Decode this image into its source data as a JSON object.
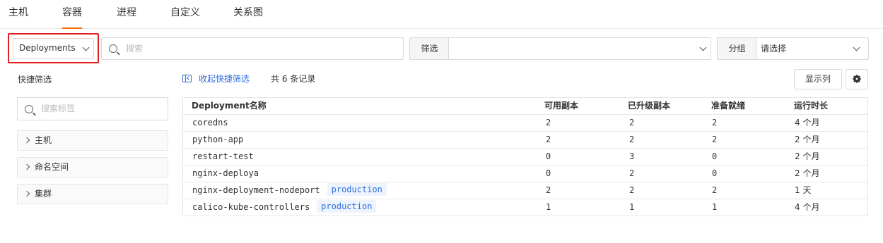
{
  "tabs": [
    {
      "label": "主机"
    },
    {
      "label": "容器"
    },
    {
      "label": "进程"
    },
    {
      "label": "自定义"
    },
    {
      "label": "关系图"
    }
  ],
  "toolbar": {
    "resource_select": "Deployments",
    "search_placeholder": "搜索",
    "filter_label": "筛选",
    "filter_value": "",
    "group_label": "分组",
    "group_placeholder": "请选择"
  },
  "quick_filter": {
    "title": "快捷筛选",
    "search_placeholder": "搜索标签",
    "items": [
      {
        "label": "主机"
      },
      {
        "label": "命名空间"
      },
      {
        "label": "集群"
      }
    ]
  },
  "list_header": {
    "collapse_label": "收起快捷筛选",
    "record_count": "共 6 条记录",
    "columns_button": "显示列"
  },
  "table": {
    "columns": [
      "Deployment名称",
      "可用副本",
      "已升级副本",
      "准备就绪",
      "运行时长"
    ],
    "rows": [
      {
        "name": "coredns",
        "tag": "",
        "available": "2",
        "updated": "2",
        "ready": "2",
        "age": "4 个月"
      },
      {
        "name": "python-app",
        "tag": "",
        "available": "2",
        "updated": "2",
        "ready": "2",
        "age": "2 个月"
      },
      {
        "name": "restart-test",
        "tag": "",
        "available": "0",
        "updated": "3",
        "ready": "0",
        "age": "2 个月"
      },
      {
        "name": "nginx-deploya",
        "tag": "",
        "available": "0",
        "updated": "2",
        "ready": "0",
        "age": "2 个月"
      },
      {
        "name": "nginx-deployment-nodeport",
        "tag": "production",
        "available": "2",
        "updated": "2",
        "ready": "2",
        "age": "1 天"
      },
      {
        "name": "calico-kube-controllers",
        "tag": "production",
        "available": "1",
        "updated": "1",
        "ready": "1",
        "age": "4 个月"
      }
    ]
  },
  "colors": {
    "accent_tab": "#ff6a00",
    "highlight_border": "#e02020",
    "link_blue": "#2f6ee0",
    "badge_bg": "#eef4fc"
  }
}
